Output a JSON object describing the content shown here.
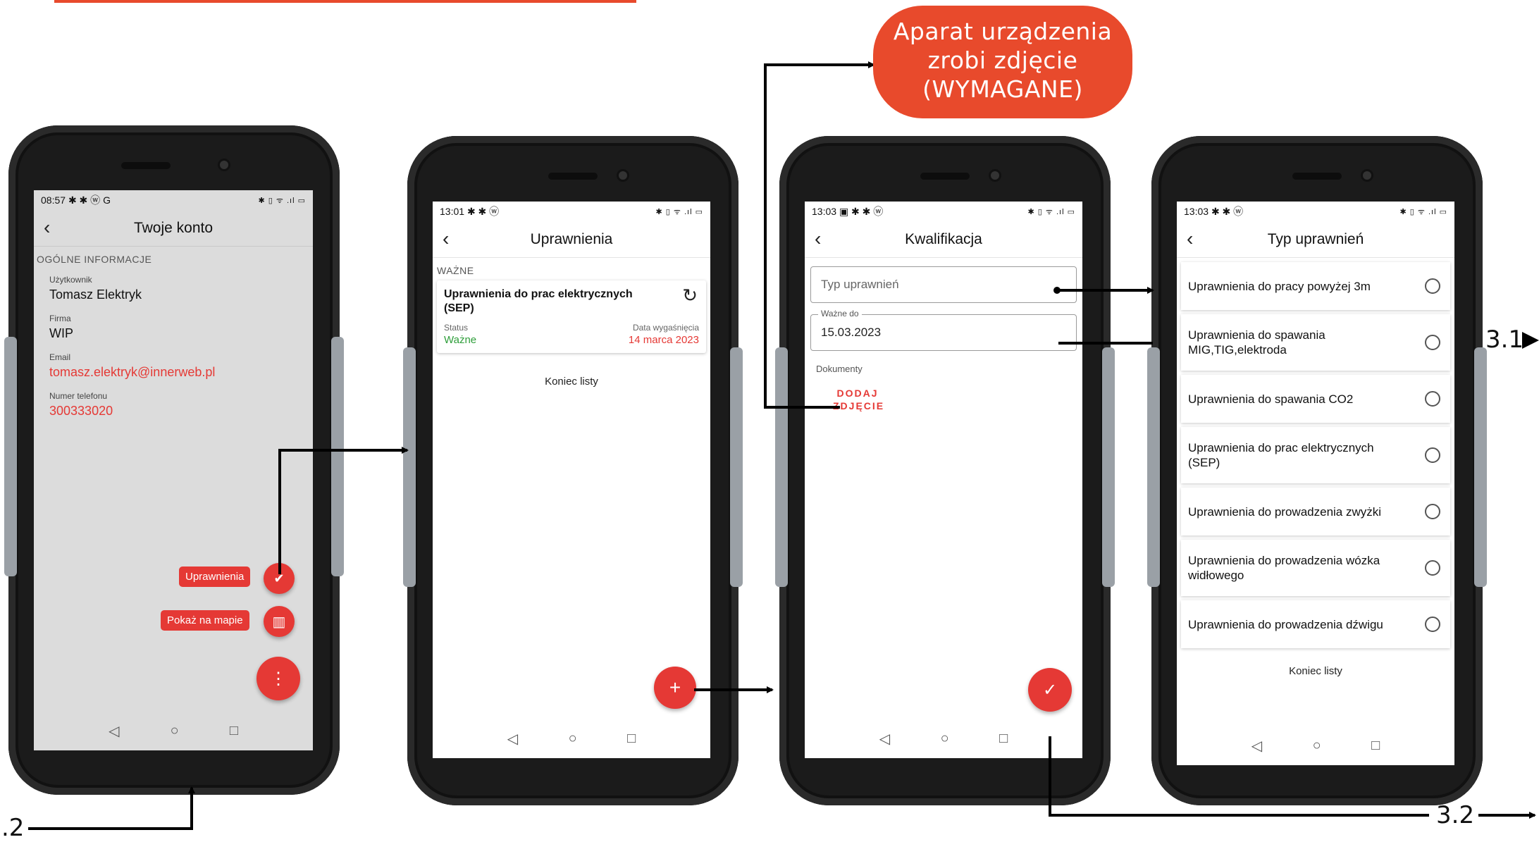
{
  "callout": {
    "line1": "Aparat urządzenia",
    "line2": "zrobi zdjęcie",
    "line3": "(WYMAGANE)"
  },
  "labels": {
    "left": ".2",
    "right_mid": "3.1",
    "bottom_right": "3.2"
  },
  "colors": {
    "accent": "#e84a2c",
    "app_red": "#e53935",
    "status_green": "#2e9e3a"
  },
  "nav_icons": {
    "back": "◁",
    "home": "○",
    "recent": "□"
  },
  "screen1": {
    "status_time": "08:57",
    "status_icons": "✱ ✱ ⓦ G",
    "status_right": "✱ ▯ ᯤ .ıl ▭",
    "title": "Twoje konto",
    "back_icon": "‹",
    "section": "OGÓLNE INFORMACJE",
    "fields": [
      {
        "label": "Użytkownik",
        "value": "Tomasz Elektryk"
      },
      {
        "label": "Firma",
        "value": "WIP"
      },
      {
        "label": "Email",
        "value": "tomasz.elektryk@innerweb.pl"
      },
      {
        "label": "Numer telefonu",
        "value": "300333020"
      }
    ],
    "pill_permissions": "Uprawnienia",
    "pill_map": "Pokaż na mapie",
    "fab_more_icon": "⋮",
    "fab_shield_icon": "✔",
    "fab_map_icon": "▥"
  },
  "screen2": {
    "status_time": "13:01",
    "status_icons": "✱ ✱ ⓦ",
    "status_right": "✱ ▯ ᯤ .ıl ▭",
    "title": "Uprawnienia",
    "back_icon": "‹",
    "section": "WAŻNE",
    "card": {
      "title": "Uprawnienia do prac elektrycznych (SEP)",
      "refresh_icon": "↻",
      "status_label": "Status",
      "status_value": "Ważne",
      "expiry_label": "Data wygaśnięcia",
      "expiry_value": "14 marca 2023"
    },
    "end": "Koniec listy",
    "fab_add_icon": "+"
  },
  "screen3": {
    "status_time": "13:03",
    "status_icons": "▣ ✱ ✱ ⓦ",
    "status_right": "✱ ▯ ᯤ .ıl ▭",
    "title": "Kwalifikacja",
    "back_icon": "‹",
    "type_placeholder": "Typ uprawnień",
    "valid_label": "Ważne do",
    "valid_value": "15.03.2023",
    "docs_label": "Dokumenty",
    "add_photo_line1": "DODAJ",
    "add_photo_line2": "ZDJĘCIE",
    "fab_check_icon": "✓"
  },
  "screen4": {
    "status_time": "13:03",
    "status_icons": "✱ ✱ ⓦ",
    "status_right": "✱ ▯ ᯤ .ıl ▭",
    "title": "Typ uprawnień",
    "back_icon": "‹",
    "options": [
      "Uprawnienia do pracy powyżej 3m",
      "Uprawnienia do spawania MIG,TIG,elektroda",
      "Uprawnienia do spawania CO2",
      "Uprawnienia do prac elektrycznych (SEP)",
      "Uprawnienia do prowadzenia zwyżki",
      "Uprawnienia do prowadzenia wózka widłowego",
      "Uprawnienia do prowadzenia dźwigu"
    ],
    "end": "Koniec listy"
  }
}
